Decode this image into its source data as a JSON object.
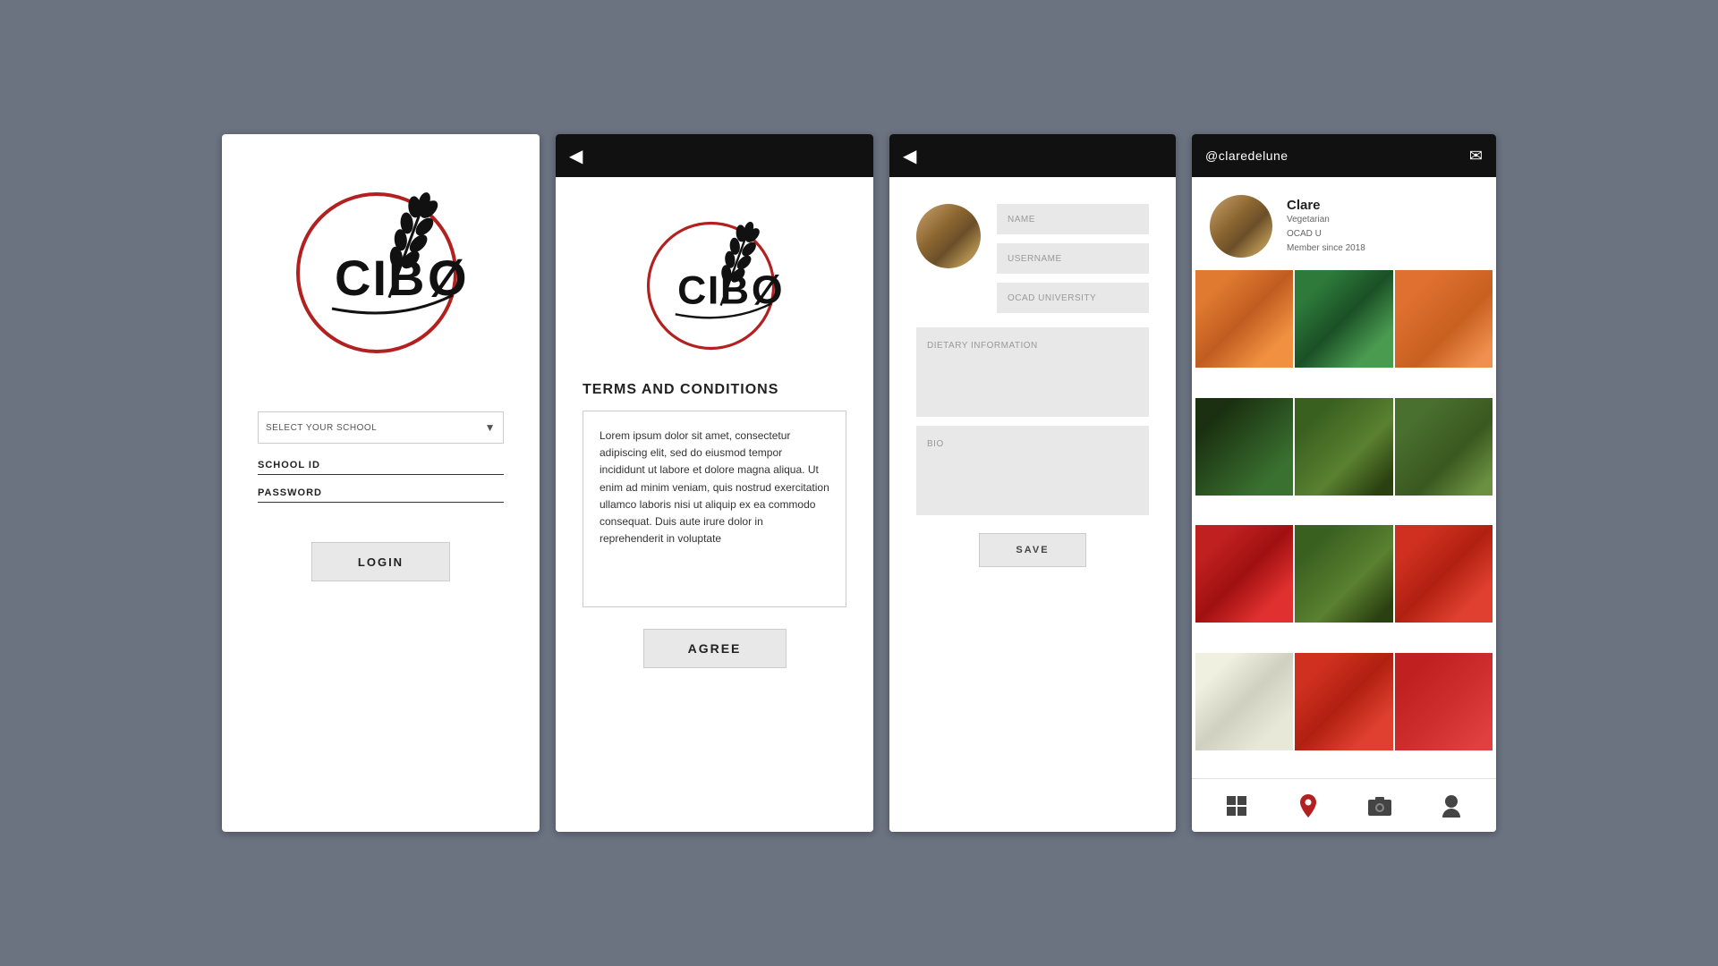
{
  "screen1": {
    "school_select_placeholder": "SELECT YOUR SCHOOL",
    "school_id_label": "SCHOOL ID",
    "password_label": "PASSWORD",
    "login_button": "LOGIN"
  },
  "screen2": {
    "terms_title": "TERMS AND CONDITIONS",
    "terms_text": "Lorem ipsum dolor sit amet, consectetur adipiscing elit, sed do eiusmod tempor incididunt ut labore et dolore magna aliqua. Ut enim ad minim veniam, quis nostrud exercitation ullamco laboris nisi ut aliquip ex ea commodo consequat. Duis aute irure dolor in reprehenderit in voluptate",
    "agree_button": "AGREE"
  },
  "screen3": {
    "name_placeholder": "NAME",
    "username_placeholder": "USERNAME",
    "school_placeholder": "OCAD UNIVERSITY",
    "dietary_placeholder": "DIETARY INFORMATION",
    "bio_placeholder": "BIO",
    "save_button": "SAVE"
  },
  "screen4": {
    "username": "@claredelune",
    "profile_name": "Clare",
    "profile_diet": "Vegetarian",
    "profile_school": "OCAD U",
    "profile_since": "Member since 2018"
  }
}
